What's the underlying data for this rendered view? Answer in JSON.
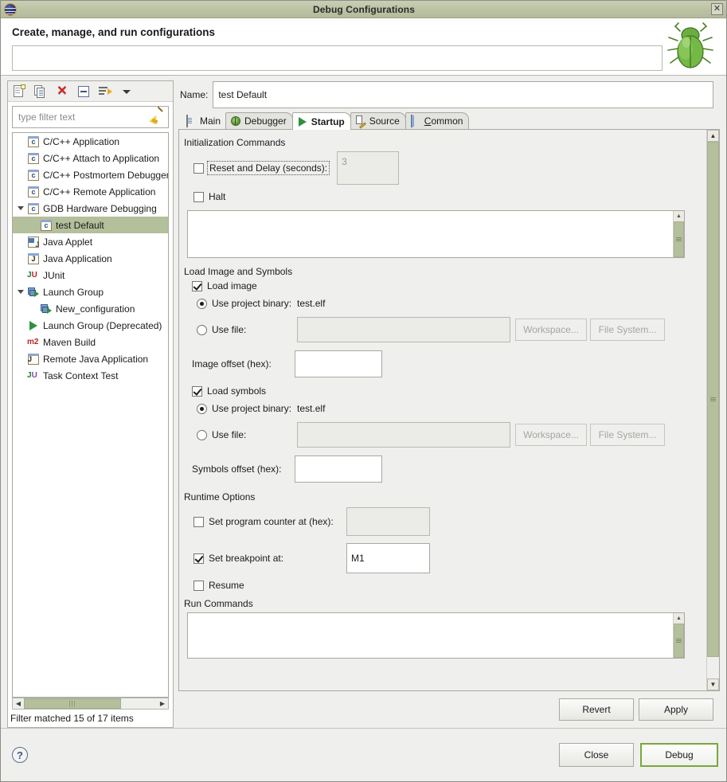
{
  "window": {
    "title": "Debug Configurations",
    "app_icon": "eclipse-icon",
    "close_icon": "window-close-icon"
  },
  "header": {
    "title": "Create, manage, and run configurations",
    "message": "",
    "bug_icon": "green-bug-icon"
  },
  "toolbar": {
    "items": [
      {
        "name": "new-configuration",
        "icon": "new-page-icon",
        "tooltip": "New launch configuration"
      },
      {
        "name": "duplicate-configuration",
        "icon": "duplicate-pages-icon",
        "tooltip": "Duplicate"
      },
      {
        "name": "delete-configuration",
        "icon": "red-x-delete-icon",
        "tooltip": "Delete"
      },
      {
        "name": "collapse-all",
        "icon": "collapse-all-icon",
        "tooltip": "Collapse All"
      },
      {
        "name": "filter-configurations",
        "icon": "filter-arrow-icon",
        "tooltip": "Filter"
      },
      {
        "name": "view-menu",
        "icon": "chevron-down-icon",
        "tooltip": "View Menu"
      }
    ]
  },
  "filter": {
    "placeholder": "type filter text",
    "value": "",
    "clear_icon": "broom-icon"
  },
  "tree": {
    "items": [
      {
        "label": "C/C++ Application",
        "icon": "c-app-icon",
        "indent": 1,
        "twisty": "none",
        "selected": false
      },
      {
        "label": "C/C++ Attach to Application",
        "icon": "c-app-icon",
        "indent": 1,
        "twisty": "none",
        "selected": false
      },
      {
        "label": "C/C++ Postmortem Debugger",
        "icon": "c-app-icon",
        "indent": 1,
        "twisty": "none",
        "selected": false
      },
      {
        "label": "C/C++ Remote Application",
        "icon": "c-app-icon",
        "indent": 1,
        "twisty": "none",
        "selected": false
      },
      {
        "label": "GDB Hardware Debugging",
        "icon": "c-app-icon",
        "indent": 0,
        "twisty": "expanded",
        "selected": false
      },
      {
        "label": "test Default",
        "icon": "c-app-icon",
        "indent": 2,
        "twisty": "none",
        "selected": true
      },
      {
        "label": "Java Applet",
        "icon": "java-applet-icon",
        "indent": 1,
        "twisty": "none",
        "selected": false
      },
      {
        "label": "Java Application",
        "icon": "java-application-icon",
        "indent": 1,
        "twisty": "none",
        "selected": false
      },
      {
        "label": "JUnit",
        "icon": "junit-icon",
        "indent": 1,
        "twisty": "none",
        "selected": false
      },
      {
        "label": "Launch Group",
        "icon": "launch-group-icon",
        "indent": 0,
        "twisty": "expanded",
        "selected": false
      },
      {
        "label": "New_configuration",
        "icon": "launch-group-icon",
        "indent": 2,
        "twisty": "none",
        "selected": false
      },
      {
        "label": "Launch Group (Deprecated)",
        "icon": "play-icon",
        "indent": 1,
        "twisty": "none",
        "selected": false
      },
      {
        "label": "Maven Build",
        "icon": "maven-icon",
        "indent": 1,
        "twisty": "none",
        "selected": false
      },
      {
        "label": "Remote Java Application",
        "icon": "remote-java-icon",
        "indent": 1,
        "twisty": "none",
        "selected": false
      },
      {
        "label": "Task Context Test",
        "icon": "task-context-icon",
        "indent": 1,
        "twisty": "none",
        "selected": false
      }
    ],
    "status": "Filter matched 15 of 17 items",
    "hscroll_left_icon": "arrow-left-icon",
    "hscroll_right_icon": "arrow-right-icon"
  },
  "name_field": {
    "label": "Name:",
    "value": "test Default"
  },
  "tabs": [
    {
      "label": "Main",
      "icon": "document-icon",
      "active": false
    },
    {
      "label": "Debugger",
      "icon": "bug-icon",
      "active": false
    },
    {
      "label": "Startup",
      "icon": "play-green-icon",
      "active": true
    },
    {
      "label": "Source",
      "icon": "source-pencil-icon",
      "active": false
    },
    {
      "label": "Common",
      "icon": "common-table-icon",
      "active": false,
      "mnemonic": "C"
    }
  ],
  "startup_tab": {
    "init_commands": {
      "group_label": "Initialization Commands",
      "reset_delay": {
        "label": "Reset and Delay (seconds):",
        "checked": false,
        "focused": true,
        "value": "3",
        "enabled": false
      },
      "halt": {
        "label": "Halt",
        "checked": false
      },
      "commands_text": ""
    },
    "load_image_symbols": {
      "group_label": "Load Image and Symbols",
      "load_image": {
        "label": "Load image",
        "checked": true
      },
      "image_use_project_binary": {
        "label": "Use project binary:",
        "value": "test.elf",
        "selected": true
      },
      "image_use_file": {
        "label": "Use file:",
        "value": "",
        "selected": false
      },
      "image_workspace_button": "Workspace...",
      "image_filesystem_button": "File System...",
      "image_offset": {
        "label": "Image offset (hex):",
        "value": ""
      },
      "load_symbols": {
        "label": "Load symbols",
        "checked": true
      },
      "symbols_use_project_binary": {
        "label": "Use project binary:",
        "value": "test.elf",
        "selected": true
      },
      "symbols_use_file": {
        "label": "Use file:",
        "value": "",
        "selected": false
      },
      "symbols_workspace_button": "Workspace...",
      "symbols_filesystem_button": "File System...",
      "symbols_offset": {
        "label": "Symbols offset (hex):",
        "value": ""
      }
    },
    "runtime_options": {
      "group_label": "Runtime Options",
      "set_pc": {
        "label": "Set program counter at (hex):",
        "checked": false,
        "value": ""
      },
      "set_breakpoint": {
        "label": "Set breakpoint at:",
        "checked": true,
        "value": "M1"
      },
      "resume": {
        "label": "Resume",
        "checked": false
      }
    },
    "run_commands": {
      "group_label": "Run Commands",
      "text": ""
    }
  },
  "footer": {
    "revert_button": "Revert",
    "apply_button": "Apply",
    "close_button": "Close",
    "debug_button": "Debug",
    "help_icon": "help-question-icon"
  },
  "colors": {
    "titlebar": "#bcc3a5",
    "selection": "#b4bf9b",
    "scroll_thumb": "#b4bf9b",
    "dialog_bg": "#efefee",
    "default_button_border": "#7aa83c",
    "delete_icon": "#cf2222"
  }
}
